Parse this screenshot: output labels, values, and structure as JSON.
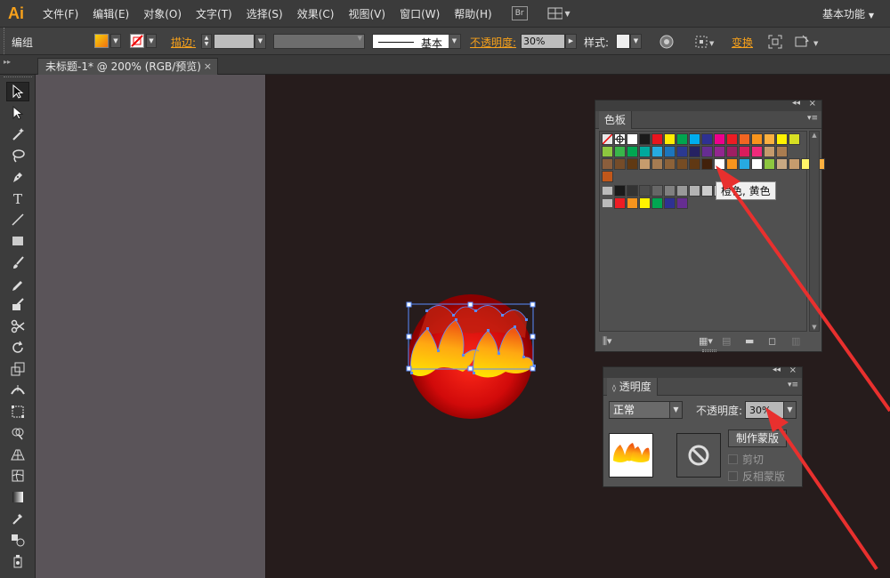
{
  "app": {
    "logo": "Ai",
    "workspace": "基本功能"
  },
  "menus": [
    "文件(F)",
    "编辑(E)",
    "对象(O)",
    "文字(T)",
    "选择(S)",
    "效果(C)",
    "视图(V)",
    "窗口(W)",
    "帮助(H)"
  ],
  "bridge_label": "Br",
  "control": {
    "selection_type": "编组",
    "stroke_label": "描边:",
    "brush_label": "基本",
    "opacity_label": "不透明度:",
    "opacity_value": "30%",
    "style_label": "样式:",
    "transform_label": "变换"
  },
  "document": {
    "tab_title": "未标题-1* @ 200% (RGB/预览)",
    "close_glyph": "×"
  },
  "swatches_panel": {
    "title": "色板",
    "tooltip": "橙色, 黄色",
    "row1": [
      "#e8e8e8",
      "#ffffff",
      "#ffffff",
      "#1a1a1a",
      "#e8141e",
      "#ffec00",
      "#00a54f",
      "#00adef",
      "#2e3192",
      "#ec008c",
      "#ed1c24",
      "#f26522",
      "#f7941d",
      "#fbb040",
      "#fff200",
      "#d7df23"
    ],
    "row2": [
      "#8dc63f",
      "#39b54a",
      "#00a651",
      "#00a99d",
      "#27aae1",
      "#1c75bc",
      "#2b3990",
      "#262262",
      "#662d91",
      "#92278f",
      "#9e1f63",
      "#da1c5c",
      "#ee2a7b",
      "#c49a6c",
      "#a97c50"
    ],
    "row3": [
      "#8b5e3c",
      "#754c29",
      "#603913",
      "#c69c6d",
      "#a67c52",
      "#8c6239",
      "#754c24",
      "#603813",
      "#42210b",
      "#ffffff",
      "#f7941d",
      "#27aae1",
      "#ffffff",
      "#8dc63f",
      "#c8a882",
      "#c69c6d",
      "#fff568",
      "#fcb040"
    ],
    "row4": [
      "#c1571a"
    ],
    "gray_group": [
      "#1a1a1a",
      "#333333",
      "#4d4d4d",
      "#666666",
      "#808080",
      "#999999",
      "#b3b3b3",
      "#cccccc",
      "#e6e6e6"
    ],
    "bright_group": [
      "#ed1c24",
      "#f7941d",
      "#fff200",
      "#00a651",
      "#2e3192",
      "#662d91"
    ]
  },
  "transparency_panel": {
    "title": "透明度",
    "blend_mode": "正常",
    "opacity_label": "不透明度:",
    "opacity_value": "30%",
    "make_mask_label": "制作蒙版",
    "clip_label": "剪切",
    "invert_label": "反相蒙版"
  },
  "colors": {
    "accent_orange": "#f7a11b",
    "annotation_red": "#e8302e"
  }
}
